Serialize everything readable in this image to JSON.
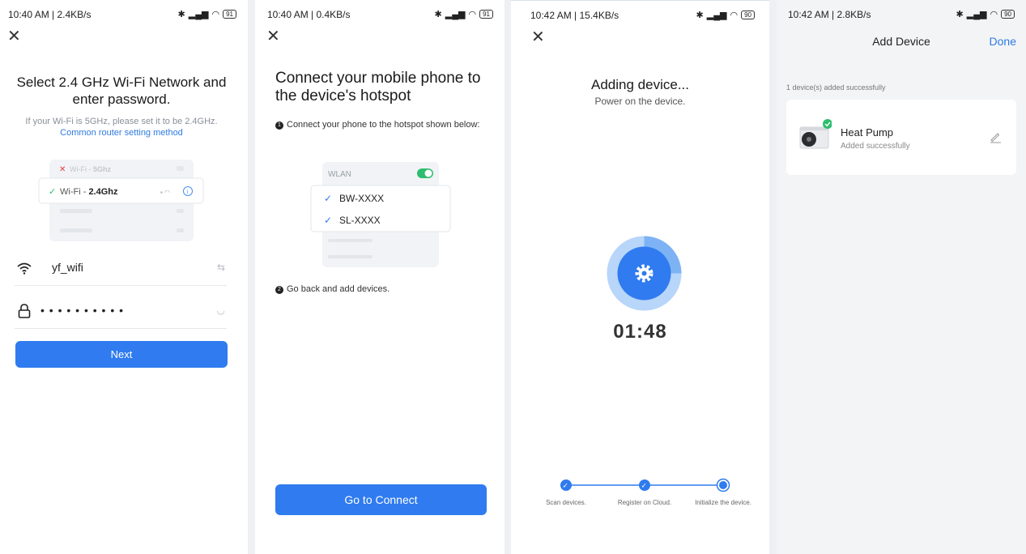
{
  "screen1": {
    "status": {
      "time": "10:40 AM | 2.4KB/s",
      "battery": "91"
    },
    "title": "Select 2.4 GHz Wi-Fi Network and enter password.",
    "hint_text": "If your Wi-Fi is 5GHz, please set it to be 2.4GHz.",
    "hint_link": "Common router setting method",
    "illus_5g_prefix": "Wi-Fi - ",
    "illus_5g_bold": "5Ghz",
    "illus_24_prefix": "Wi-Fi - ",
    "illus_24_bold": "2.4Ghz",
    "wifi_name": "yf_wifi",
    "password_mask": "• • • • • • • • • •",
    "next_button": "Next"
  },
  "screen2": {
    "status": {
      "time": "10:40 AM | 0.4KB/s",
      "battery": "91"
    },
    "title": "Connect your mobile phone to the device's hotspot",
    "step1_num": "1",
    "step1": "Connect your phone to the hotspot shown below:",
    "wlan_label": "WLAN",
    "networks": [
      "BW-XXXX",
      "SL-XXXX"
    ],
    "step2_num": "2",
    "step2": "Go back and add devices.",
    "connect_button": "Go to Connect"
  },
  "screen3": {
    "status": {
      "time": "10:42 AM | 15.4KB/s",
      "battery": "90"
    },
    "title": "Adding device...",
    "subtitle": "Power on the device.",
    "timer": "01:48",
    "steps": [
      {
        "label": "Scan devices."
      },
      {
        "label": "Register on Cloud."
      },
      {
        "label": "Initialize the device."
      }
    ]
  },
  "screen4": {
    "status": {
      "time": "10:42 AM | 2.8KB/s",
      "battery": "90"
    },
    "title": "Add Device",
    "done": "Done",
    "added_count": "1 device(s) added successfully",
    "device": {
      "name": "Heat Pump",
      "status": "Added successfully"
    }
  },
  "colors": {
    "accent": "#2f7bef",
    "success": "#2dbd6e",
    "error": "#e23b3b"
  }
}
